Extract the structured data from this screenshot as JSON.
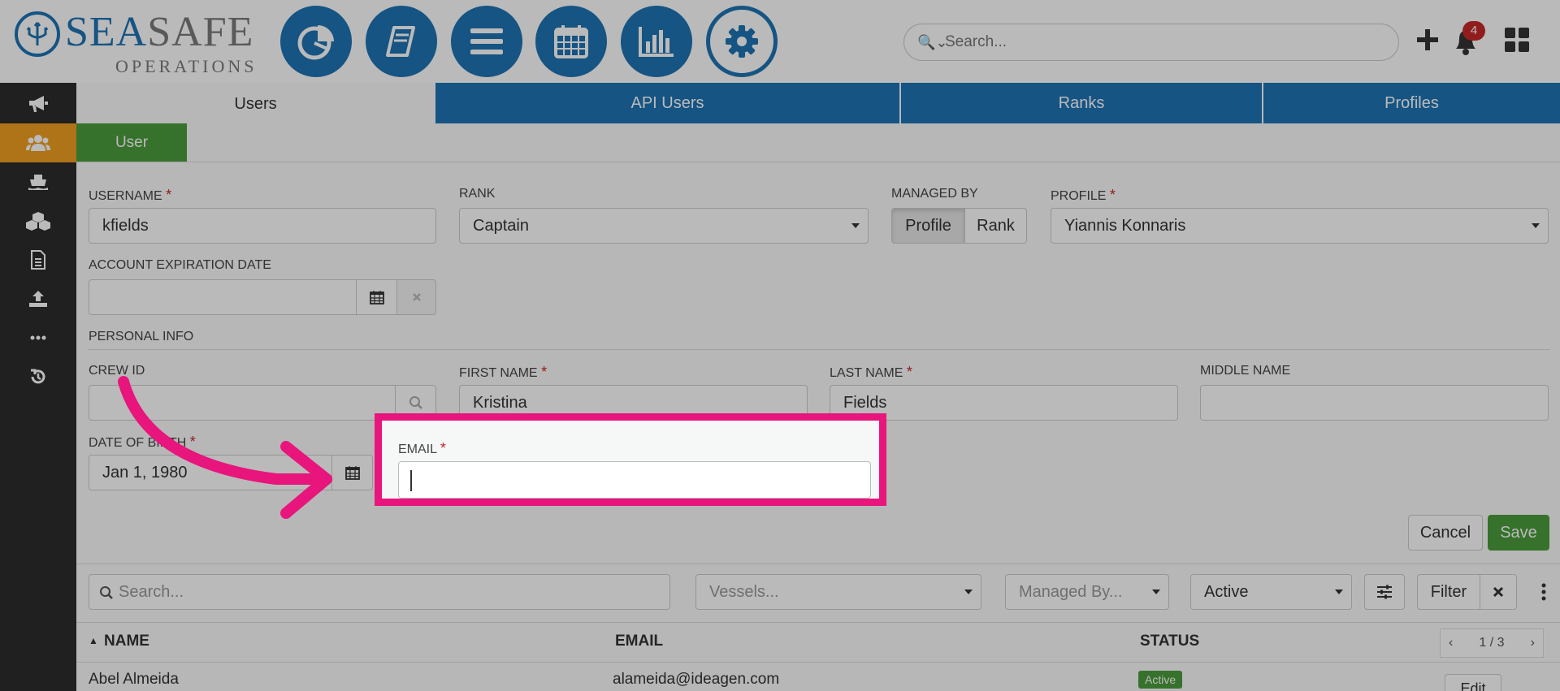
{
  "brand": {
    "name_part1": "SEA",
    "name_part2": "SAFE",
    "subtitle": "OPERATIONS"
  },
  "top_nav": [
    {
      "icon": "pie-chart-icon"
    },
    {
      "icon": "book-icon"
    },
    {
      "icon": "list-icon"
    },
    {
      "icon": "calendar-icon"
    },
    {
      "icon": "bar-chart-icon"
    },
    {
      "icon": "gear-icon",
      "selected": true
    }
  ],
  "header": {
    "search_placeholder": "Search...",
    "notifications_count": "4"
  },
  "sidebar": [
    {
      "icon": "megaphone-icon"
    },
    {
      "icon": "users-icon",
      "active": true
    },
    {
      "icon": "ship-icon"
    },
    {
      "icon": "cubes-icon"
    },
    {
      "icon": "document-icon"
    },
    {
      "icon": "upload-icon"
    },
    {
      "icon": "ellipsis-icon"
    },
    {
      "icon": "history-icon"
    }
  ],
  "tabs": [
    "Users",
    "API Users",
    "Ranks",
    "Profiles"
  ],
  "subtab": "User",
  "form": {
    "username": {
      "label": "USERNAME",
      "required": "*",
      "value": "kfields"
    },
    "rank": {
      "label": "RANK",
      "value": "Captain"
    },
    "managed_by": {
      "label": "MANAGED BY",
      "options": [
        "Profile",
        "Rank"
      ],
      "selected": "Profile"
    },
    "profile": {
      "label": "PROFILE",
      "required": "*",
      "value": "Yiannis Konnaris"
    },
    "account_expiration": {
      "label": "ACCOUNT EXPIRATION DATE",
      "value": ""
    },
    "personal_info_label": "PERSONAL INFO",
    "crew_id": {
      "label": "CREW ID",
      "value": ""
    },
    "first_name": {
      "label": "FIRST NAME",
      "required": "*",
      "value": "Kristina"
    },
    "last_name": {
      "label": "LAST NAME",
      "required": "*",
      "value": "Fields"
    },
    "middle_name": {
      "label": "MIDDLE NAME",
      "value": ""
    },
    "date_of_birth": {
      "label": "DATE OF BIRTH",
      "required": "*",
      "value": "Jan 1, 1980"
    },
    "email": {
      "label": "EMAIL",
      "required": "*",
      "value": ""
    },
    "cancel_label": "Cancel",
    "save_label": "Save"
  },
  "list_filters": {
    "search_placeholder": "Search...",
    "vessels_placeholder": "Vessels...",
    "managed_by_placeholder": "Managed By...",
    "status_value": "Active",
    "filter_label": "Filter"
  },
  "table": {
    "headers": {
      "name": "NAME",
      "email": "EMAIL",
      "status": "STATUS"
    },
    "pagination": "1 / 3",
    "rows": [
      {
        "name": "Abel Almeida",
        "email": "alameida@ideagen.com",
        "status": "Active",
        "action": "Edit"
      }
    ]
  },
  "colors": {
    "primary": "#1e73b4",
    "success": "#4a9d3c",
    "warning": "#f0a020",
    "highlight": "#e8157c",
    "sidebar": "#2d2d2d"
  }
}
